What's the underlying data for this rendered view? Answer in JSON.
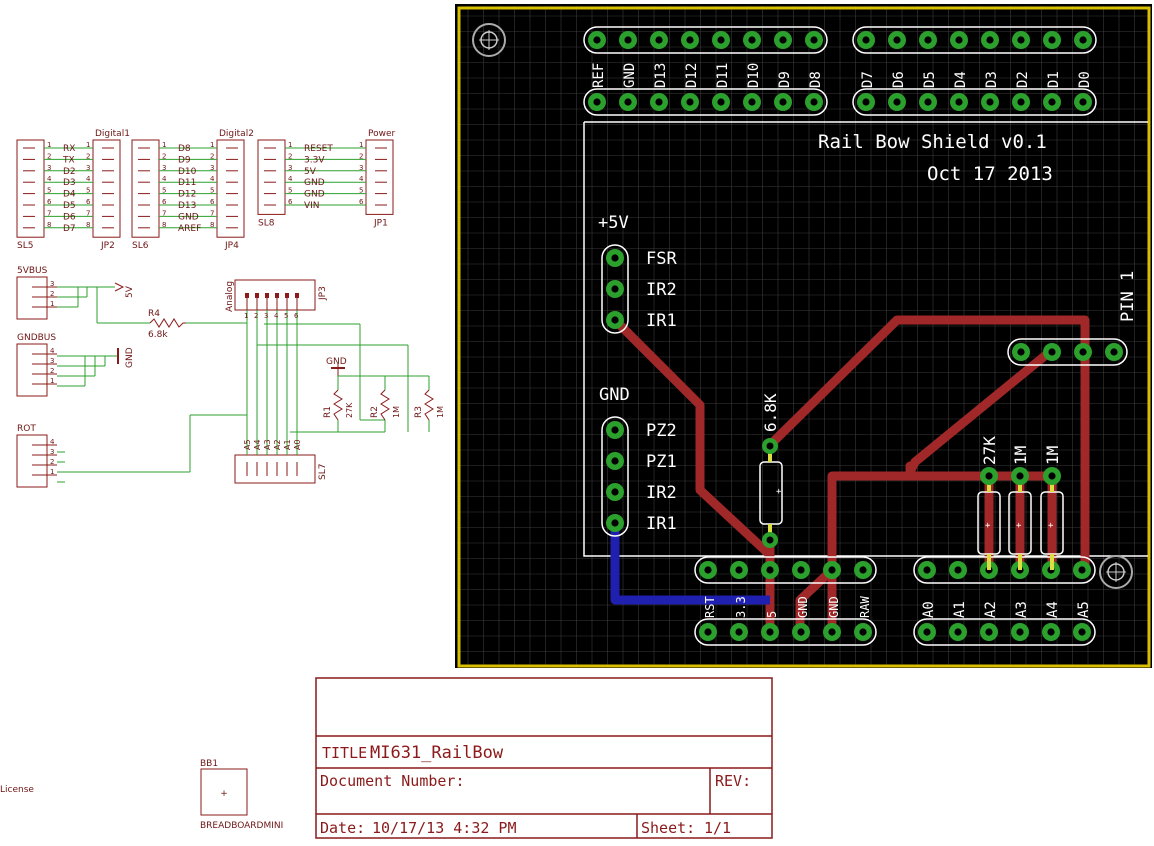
{
  "schematic": {
    "headers": [
      {
        "ref_left": "SL5",
        "ref_right": "JP2",
        "title": "Digital1",
        "signals": [
          "RX",
          "TX",
          "D2",
          "D3",
          "D4",
          "D5",
          "D6",
          "D7"
        ]
      },
      {
        "ref_left": "SL6",
        "ref_right": "JP4",
        "title": "Digital2",
        "signals": [
          "D8",
          "D9",
          "D10",
          "D11",
          "D12",
          "D13",
          "GND",
          "AREF"
        ]
      },
      {
        "ref_left": "SL8",
        "ref_right": "JP1",
        "title": "Power",
        "signals": [
          "RESET",
          "3.3V",
          "5V",
          "GND",
          "GND",
          "VIN"
        ]
      }
    ],
    "buses": [
      {
        "label": "5VBUS",
        "pins": [
          "3",
          "2",
          "1"
        ]
      },
      {
        "label": "GNDBUS",
        "pins": [
          "4",
          "3",
          "2",
          "1"
        ]
      },
      {
        "label": "ROT",
        "pins": [
          "4",
          "3",
          "2",
          "1"
        ]
      }
    ],
    "net_5v": "5V",
    "net_gnd": "GND",
    "r4": {
      "name": "R4",
      "value": "6.8k"
    },
    "analog": {
      "name": "Analog",
      "ref_top": "JP3",
      "ref_bottom": "SL7",
      "pins": [
        "A5",
        "A4",
        "A3",
        "A2",
        "A1",
        "A0"
      ],
      "pin_numbers": [
        "1",
        "2",
        "3",
        "4",
        "5",
        "6"
      ]
    },
    "gnd_symbol": "GND",
    "resistors": [
      {
        "name": "R1",
        "value": "27K"
      },
      {
        "name": "R2",
        "value": "1M"
      },
      {
        "name": "R3",
        "value": "1M"
      }
    ],
    "bb": {
      "name": "BB1",
      "value": "BREADBOARDMINI"
    },
    "license": "License"
  },
  "board": {
    "title": "Rail Bow Shield v0.1",
    "date": "Oct 17 2013",
    "top_left_labels": [
      "REF",
      "GND",
      "D13",
      "D12",
      "D11",
      "D10",
      "D9",
      "D8"
    ],
    "top_right_labels": [
      "D7",
      "D6",
      "D5",
      "D4",
      "D3",
      "D2",
      "D1",
      "D0"
    ],
    "plus5v": "+5V",
    "group1": [
      "FSR",
      "IR2",
      "IR1"
    ],
    "gnd": "GND",
    "group2": [
      "PZ2",
      "PZ1",
      "IR2",
      "IR1"
    ],
    "pin1": "PIN 1",
    "r_68k": "6.8K",
    "r_labels": [
      "27K",
      "1M",
      "1M"
    ],
    "bottom_power_labels": [
      "RST",
      "3.3",
      "5",
      "GND",
      "GND",
      "RAW"
    ],
    "bottom_analog_labels": [
      "A0",
      "A1",
      "A2",
      "A3",
      "A4",
      "A5"
    ],
    "colors": {
      "copper_top": "#a02828",
      "copper_bottom": "#2020b0",
      "pad": "#2ca02c",
      "silk": "#ffffff",
      "outline": "#d8c000"
    }
  },
  "frame": {
    "title_label": "TITLE:",
    "title_value": "MI631_RailBow",
    "doc_label": "Document Number:",
    "rev_label": "REV:",
    "date_label": "Date:",
    "date_value": "10/17/13 4:32 PM",
    "sheet_label": "Sheet:",
    "sheet_value": "1/1"
  }
}
